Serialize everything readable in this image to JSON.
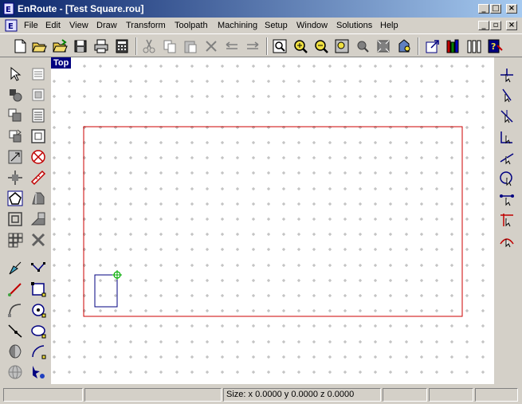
{
  "window": {
    "title": "EnRoute - [Test Square.rou]",
    "controls": {
      "minimize": "_",
      "maximize": "□",
      "close": "×"
    }
  },
  "menu": {
    "items": [
      "File",
      "Edit",
      "View",
      "Draw",
      "Transform",
      "Toolpath",
      "Machining",
      "Setup",
      "Window",
      "Solutions",
      "Help"
    ]
  },
  "toolbar": {
    "icons": [
      "new-file-icon",
      "open-file-icon",
      "open-file-2-icon",
      "save-icon",
      "print-icon",
      "calculator-icon",
      "cut-icon",
      "copy-icon",
      "paste-icon",
      "delete-icon",
      "undo-icon",
      "redo-icon",
      "zoom-select-icon",
      "zoom-in-icon",
      "zoom-out-icon",
      "zoom-fit-icon",
      "zoom-pan-icon",
      "zoom-extent-icon",
      "render-icon",
      "export-icon",
      "library-icon",
      "columns-icon",
      "help-icon"
    ]
  },
  "view": {
    "label": "Top"
  },
  "colors": {
    "accent_red": "#cc0000",
    "rect_blue": "#000080",
    "green_marker": "#00aa00",
    "title_blue": "#0a246a"
  },
  "status": {
    "size_text": "Size: x 0.0000   y 0.0000   z 0.0000"
  }
}
